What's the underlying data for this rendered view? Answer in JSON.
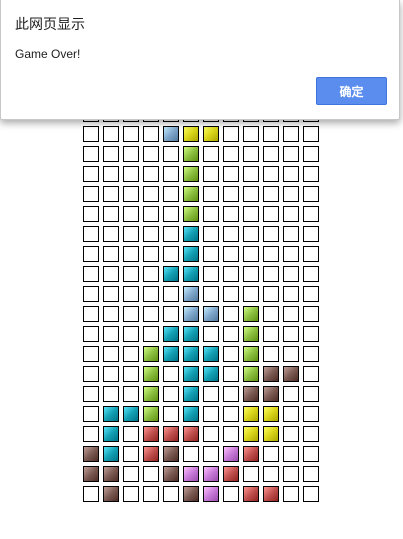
{
  "dialog": {
    "title": "此网页显示",
    "message": "Game Over!",
    "ok_label": "确定"
  },
  "palette": {
    "empty": "#ffffff",
    "B": "#7fa7cc",
    "Y": "#d9d41a",
    "G": "#8cbf3f",
    "T": "#14a0b4",
    "R": "#c0504d",
    "M": "#7a5a52",
    "P": "#c77ad8"
  },
  "board": {
    "columns": 12,
    "rows": [
      "............",
      "....BYY.....",
      ".....G......",
      ".....G......",
      ".....G......",
      ".....G......",
      ".....T......",
      ".....T......",
      "....TT......",
      ".....B......",
      ".....BB.G...",
      "....TT..G...",
      "...GTTT.G...",
      "...G.TT.GMM.",
      "...G.T..MM..",
      ".TTG.T..YY..",
      ".T.RRR..YY..",
      "MT.RM..PR...",
      "MM..MPPR....",
      ".M...MP.RR.."
    ]
  }
}
